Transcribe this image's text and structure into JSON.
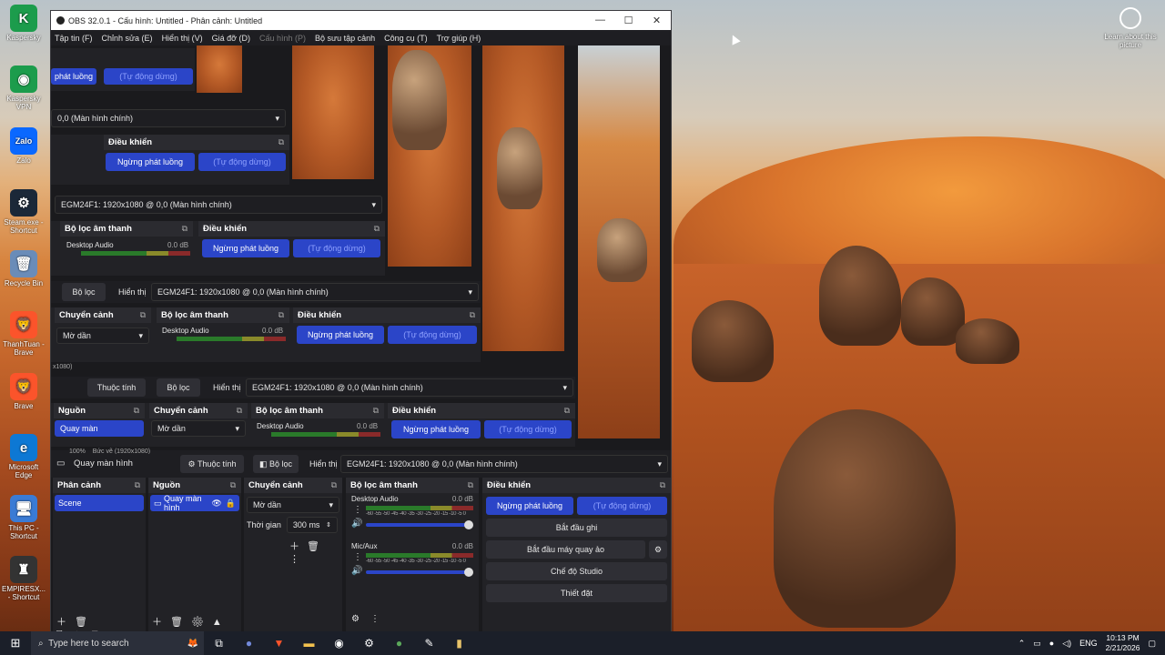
{
  "desktop": {
    "icons": [
      {
        "label": "Kaspersky",
        "glyph": "K",
        "color": "#1c9c4c"
      },
      {
        "label": "Kaspersky VPN",
        "glyph": "◉",
        "color": "#1c9c4c"
      },
      {
        "label": "Zalo",
        "glyph": "Zalo",
        "color": "#0a68ff"
      },
      {
        "label": "Steam.exe - Shortcut",
        "glyph": "⚙",
        "color": "#1b2838"
      },
      {
        "label": "Recycle Bin",
        "glyph": "🗑",
        "color": "#6a8cb8"
      },
      {
        "label": "ThanhTuan - Brave",
        "glyph": "🦁",
        "color": "#fb542b"
      },
      {
        "label": "Brave",
        "glyph": "🦁",
        "color": "#fb542b"
      },
      {
        "label": "Microsoft Edge",
        "glyph": "e",
        "color": "#0d78d4"
      },
      {
        "label": "This PC - Shortcut",
        "glyph": "🖥",
        "color": "#3a7bd5"
      },
      {
        "label": "EMPIRESX... - Shortcut",
        "glyph": "♜",
        "color": "#333"
      }
    ],
    "learn_about": "Learn about this picture"
  },
  "obs": {
    "title": "OBS 32.0.1 - Cấu hình: Untitled - Phân cảnh: Untitled",
    "menu": [
      "Tập tin (F)",
      "Chỉnh sửa (E)",
      "Hiển thị (V)",
      "Giá đỡ (D)",
      "Cấu hình (P)",
      "Bộ sưu tập cảnh",
      "Công cụ (T)",
      "Trợ giúp (H)"
    ],
    "source_toolbar": {
      "source_name": "Quay màn hình",
      "properties": "Thuộc tính",
      "filters": "Bộ lọc",
      "display_label": "Hiển thị",
      "display_value": "EGM24F1: 1920x1080 @ 0,0 (Màn hình chính)"
    },
    "docks": {
      "scenes": {
        "title": "Phân cảnh",
        "items": [
          "Scene"
        ]
      },
      "sources": {
        "title": "Nguồn",
        "items": [
          "Quay màn hình"
        ]
      },
      "transitions": {
        "title": "Chuyển cảnh",
        "type": "Mờ dần",
        "duration_label": "Thời gian",
        "duration": "300 ms"
      },
      "mixer": {
        "title": "Bộ lọc âm thanh",
        "channels": [
          {
            "name": "Desktop Audio",
            "db": "0.0 dB"
          },
          {
            "name": "Mic/Aux",
            "db": "0.0 dB"
          }
        ],
        "ticks": "-60 -55 -50 -45 -40 -35 -30 -25 -20 -15 -10 -5 0"
      },
      "controls": {
        "title": "Điều khiển",
        "stop_stream": "Ngừng phát luồng",
        "auto": "(Tự động dừng)",
        "start_record": "Bắt đầu ghi",
        "virtual_cam": "Bắt đầu máy quay ảo",
        "studio_mode": "Chế độ Studio",
        "settings": "Thiết đặt"
      }
    },
    "preview_zoom": "100%",
    "preview_canvas": "Bức vẽ (1920x1080)",
    "fragment_label": "Nguồn",
    "fragment_source": "Quay màn",
    "fragment_short_stream": "phát luồng",
    "fragment_monitor": "0,0 (Màn hình chính)",
    "fragment_res": "x1080)"
  },
  "taskbar": {
    "search_placeholder": "Type here to search",
    "lang": "ENG",
    "time": "10:13 PM",
    "date": "2/21/2026"
  }
}
